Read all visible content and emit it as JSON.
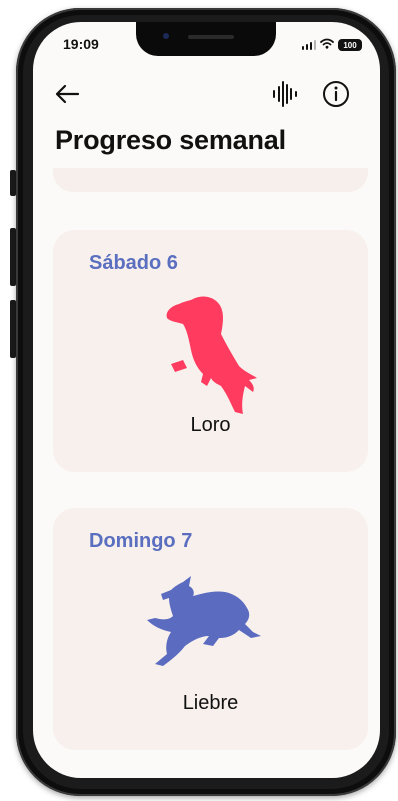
{
  "status_bar": {
    "time": "19:09",
    "battery": "100"
  },
  "nav": {
    "back_icon": "arrow-left-icon",
    "audio_icon": "sound-wave-icon",
    "info_icon": "info-circle-icon"
  },
  "page_title": "Progreso semanal",
  "days": [
    {
      "day": "Sábado 6",
      "animal": "Loro",
      "icon": "parrot-icon",
      "color": "#ff3b5f"
    },
    {
      "day": "Domingo 7",
      "animal": "Liebre",
      "icon": "hare-icon",
      "color": "#5b6cc0"
    }
  ],
  "colors": {
    "background": "#fcfaf8",
    "card": "#f7f0ec",
    "day_label": "#5b6fc0"
  }
}
